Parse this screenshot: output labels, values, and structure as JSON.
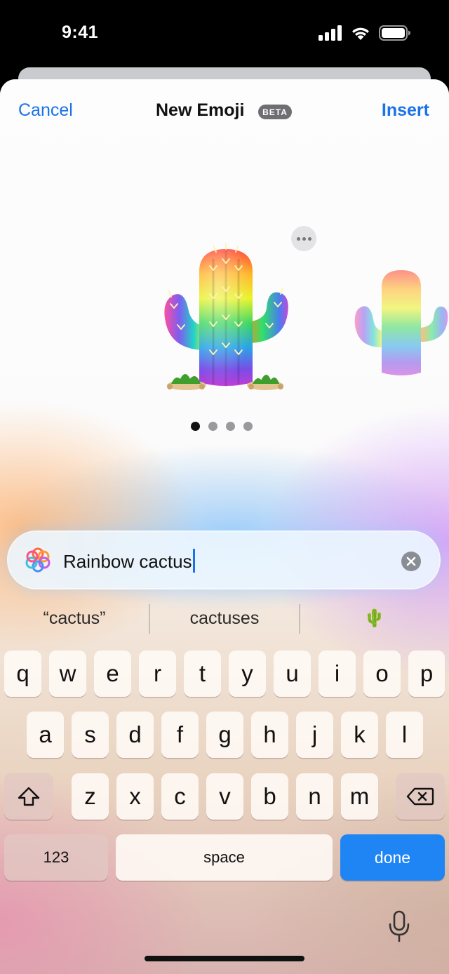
{
  "status_bar": {
    "time": "9:41"
  },
  "nav": {
    "cancel": "Cancel",
    "title": "New Emoji",
    "badge": "BETA",
    "insert": "Insert"
  },
  "carousel": {
    "pages": 4,
    "active_page": 1,
    "emoji_name": "Rainbow cactus"
  },
  "input": {
    "value": "Rainbow cactus"
  },
  "suggestions": [
    "“cactus”",
    "cactuses",
    "🌵"
  ],
  "keyboard": {
    "row1": [
      "q",
      "w",
      "e",
      "r",
      "t",
      "y",
      "u",
      "i",
      "o",
      "p"
    ],
    "row2": [
      "a",
      "s",
      "d",
      "f",
      "g",
      "h",
      "j",
      "k",
      "l"
    ],
    "row3": [
      "z",
      "x",
      "c",
      "v",
      "b",
      "n",
      "m"
    ],
    "numbers": "123",
    "space": "space",
    "done": "done"
  },
  "colors": {
    "accent": "#1a73e8",
    "done_key": "#1f85f5"
  }
}
